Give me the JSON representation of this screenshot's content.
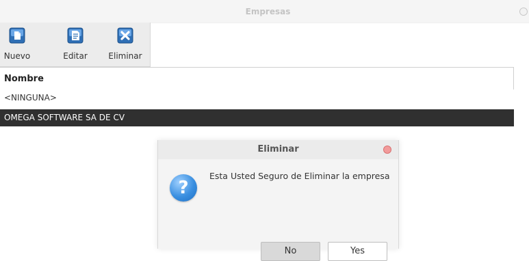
{
  "window": {
    "title": "Empresas"
  },
  "toolbar": {
    "new_label": "Nuevo",
    "edit_label": "Editar",
    "delete_label": "Eliminar"
  },
  "list": {
    "header": "Nombre",
    "rows": [
      "<NINGUNA>",
      "OMEGA SOFTWARE SA DE CV"
    ],
    "selected_index": 1
  },
  "dialog": {
    "title": "Eliminar",
    "message": "Esta Usted Seguro de Eliminar la empresa",
    "icon": "question-icon",
    "no_label": "No",
    "yes_label": "Yes"
  },
  "colors": {
    "selection": "#303030",
    "question_icon": "#3a8fe0",
    "dialog_close": "#f29b9b"
  }
}
